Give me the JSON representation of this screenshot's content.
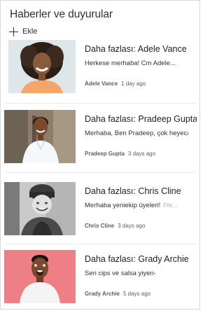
{
  "webpart": {
    "title": "Haberler ve duyurular",
    "add_label": "Ekle"
  },
  "news": [
    {
      "heading": "Daha fazlası: Adele Vance",
      "snippet": "Herkese merhaba! Cm Adele...",
      "snippet_more": "",
      "author": "Adele Vance",
      "date": "1 day ago",
      "thumb_icon": "woman-smiling-portrait"
    },
    {
      "heading": "Daha fazlası: Pradeep Gupta",
      "snippet": "Merhaba, Ben Pradeep, çok heyecanlıyım...",
      "snippet_more": "",
      "author": "Pradeep Gupta",
      "date": "3 days ago",
      "thumb_icon": "man-in-shirt-portrait"
    },
    {
      "heading": "Daha fazlası: Chris Cline",
      "snippet": "Merhaba yeniekip üyeleri!",
      "snippet_more": "I'm...",
      "author": "Chris Cline",
      "date": "3 days ago",
      "thumb_icon": "woman-beanie-portrait"
    },
    {
      "heading": "Daha fazlası: Grady Archie",
      "snippet": "Seri cips ve salsa yiyen-",
      "snippet_more": "",
      "author": "Grady Archie",
      "date": "5 days ago",
      "thumb_icon": "excited-man-portrait"
    }
  ]
}
